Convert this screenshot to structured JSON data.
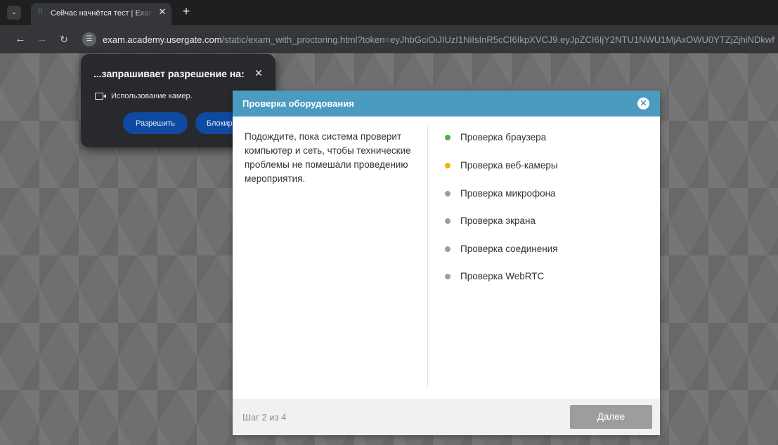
{
  "browser": {
    "tab": {
      "title": "Сейчас начнётся тест | Exam UserGate",
      "audio_icon": "audio-wave-icon"
    },
    "new_tab_label": "+",
    "url_host": "exam.academy.usergate.com",
    "url_path": "/static/exam_with_proctoring.html?token=eyJhbGciOiJIUzI1NiIsInR5cCI6IkpXVCJ9.eyJpZCI6IjY2NTU1NWU1MjAxOWU0YTZjZjhiNDkwMSIsImhvc3QiOi"
  },
  "permission": {
    "title": "...запрашивает разрешение на:",
    "item": "Использование камер.",
    "allow_label": "Разрешить",
    "block_label": "Блокировать"
  },
  "modal": {
    "title": "Проверка оборудования",
    "description": "Подождите, пока система проверит компьютер и сеть, чтобы технические проблемы не помешали проведению мероприятия.",
    "checks": [
      {
        "label": "Проверка браузера",
        "status": "done",
        "color": "#4caf50"
      },
      {
        "label": "Проверка веб-камеры",
        "status": "in-progress",
        "color": "#f4b400"
      },
      {
        "label": "Проверка микрофона",
        "status": "pending",
        "color": "#9e9e9e"
      },
      {
        "label": "Проверка экрана",
        "status": "pending",
        "color": "#9e9e9e"
      },
      {
        "label": "Проверка соединения",
        "status": "pending",
        "color": "#9e9e9e"
      },
      {
        "label": "Проверка WebRTC",
        "status": "pending",
        "color": "#9e9e9e"
      }
    ],
    "step": "Шаг 2 из 4",
    "next_label": "Далее",
    "header_color": "#4b9ac0"
  }
}
